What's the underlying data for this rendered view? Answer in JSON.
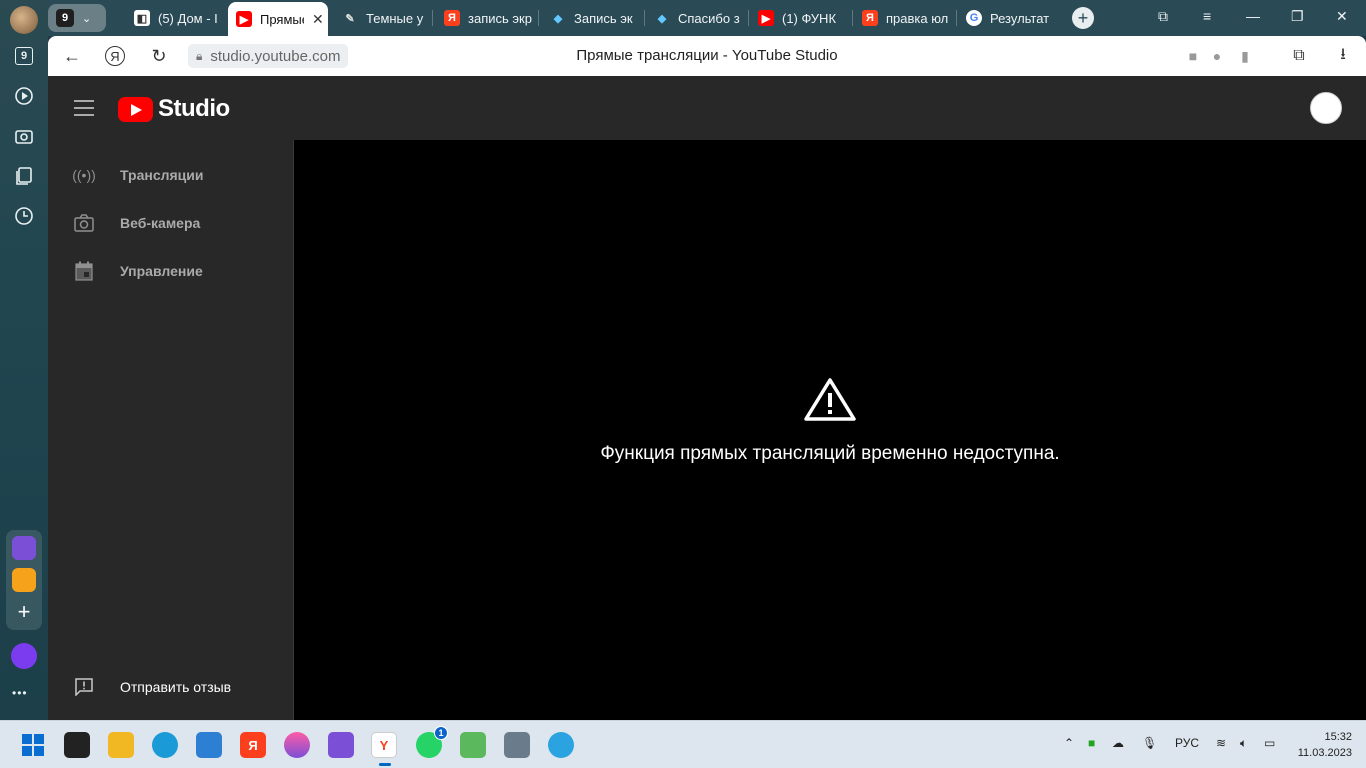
{
  "sidebar": {
    "tab_count_badge": "9",
    "apps_more": "•••"
  },
  "tabs": {
    "count": "9",
    "items": [
      {
        "label": "(5) Дом - I",
        "icon": "roblox-icon"
      },
      {
        "label": "Прямые",
        "icon": "youtube-icon",
        "active": true
      },
      {
        "label": "Темные у",
        "icon": "page-icon"
      },
      {
        "label": "запись экр",
        "icon": "yandex-icon"
      },
      {
        "label": "Запись эк",
        "icon": "app-icon"
      },
      {
        "label": "Спасибо з",
        "icon": "app-icon"
      },
      {
        "label": "(1) ФУНК",
        "icon": "youtube-icon"
      },
      {
        "label": "правка юл",
        "icon": "yandex-icon"
      },
      {
        "label": "Результат",
        "icon": "google-icon"
      }
    ]
  },
  "address_bar": {
    "url": "studio.youtube.com",
    "page_title": "Прямые трансляции - YouTube Studio"
  },
  "studio": {
    "logo_text": "Studio",
    "nav": [
      {
        "label": "Трансляции",
        "icon": "broadcast-icon"
      },
      {
        "label": "Веб-камера",
        "icon": "camera-icon"
      },
      {
        "label": "Управление",
        "icon": "calendar-icon"
      }
    ],
    "feedback_label": "Отправить отзыв",
    "error_message": "Функция прямых трансляций временно недоступна."
  },
  "taskbar": {
    "language": "РУС",
    "time": "15:32",
    "date": "11.03.2023",
    "whatsapp_badge": "1"
  },
  "colors": {
    "accent_red": "#ff0000",
    "studio_bg": "#282828",
    "main_bg": "#000000"
  }
}
